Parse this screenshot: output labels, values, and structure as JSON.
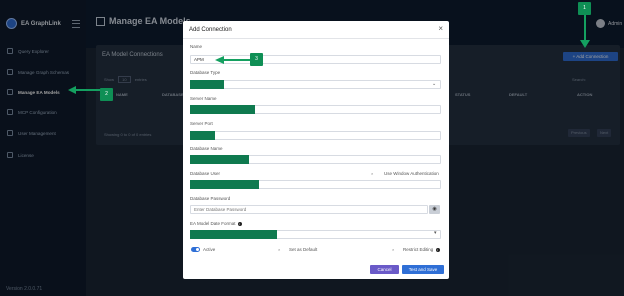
{
  "app": {
    "brand": "EA GraphLink",
    "version": "Version 2.0.0.71"
  },
  "sidebar": {
    "items": [
      {
        "label": "Query Explorer",
        "icon": "search-icon"
      },
      {
        "label": "Manage Graph Schemas",
        "icon": "schema-icon"
      },
      {
        "label": "Manage EA Models",
        "icon": "database-icon",
        "active": true
      },
      {
        "label": "MCP Configuration",
        "icon": "gear-icon"
      },
      {
        "label": "User Management",
        "icon": "users-icon"
      },
      {
        "label": "License",
        "icon": "license-icon"
      }
    ]
  },
  "header": {
    "page_title": "Manage EA Models",
    "user_name": "Admin"
  },
  "main": {
    "card_title": "EA Model Connections",
    "add_button": "+ Add Connection",
    "show_label": "Show",
    "show_value": "10",
    "entries_label": "entries",
    "search_label": "Search:",
    "columns": [
      "NAME",
      "DATABASE",
      "STATUS",
      "DEFAULT",
      "ACTION"
    ],
    "showing_text": "Showing 0 to 0 of 0 entries",
    "pagination": {
      "previous": "Previous",
      "next": "Next"
    }
  },
  "modal": {
    "title": "Add Connection",
    "close_symbol": "×",
    "fields": {
      "name": {
        "label": "Name",
        "value": "APM"
      },
      "db_type": {
        "label": "Database Type"
      },
      "server_name": {
        "label": "Server Name"
      },
      "server_port": {
        "label": "Server Port"
      },
      "database_name": {
        "label": "Database Name"
      },
      "database_user": {
        "label": "Database User"
      },
      "database_password": {
        "label": "Database Password",
        "placeholder": "Enter Database Password"
      },
      "date_format": {
        "label": "EA Model Date Format"
      }
    },
    "windows_auth_label": "Use Window Authentication",
    "active_label": "Active",
    "set_default_label": "Set as Default",
    "restrict_editing_label": "Restrict Editing",
    "cancel_button": "Cancel",
    "save_button": "Test and Save"
  },
  "annotations": {
    "badge_1": "1",
    "badge_2": "2",
    "badge_3": "3"
  },
  "colors": {
    "primary": "#2f6fd6",
    "cancel": "#6a5ac8",
    "annotation": "#0f8f55",
    "sidebar": "#0f1b2d"
  }
}
